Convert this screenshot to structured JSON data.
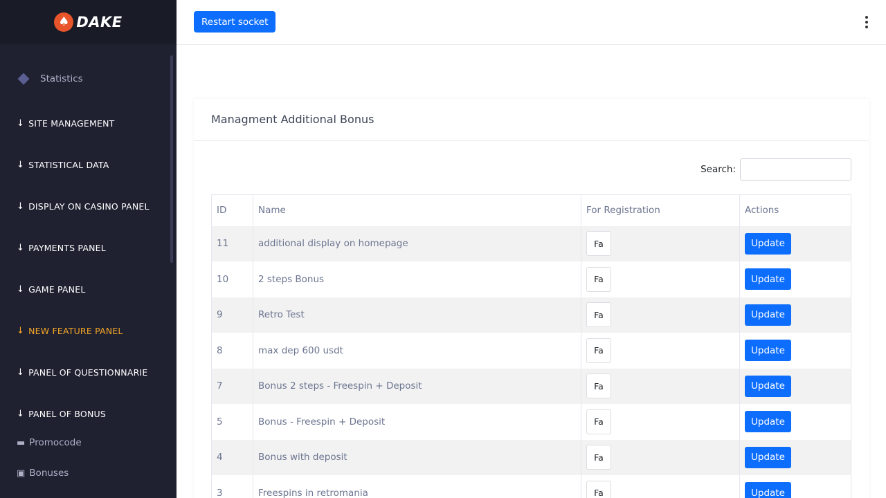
{
  "brand": {
    "name": "DAKE",
    "logo_icon": "spade-icon"
  },
  "topbar": {
    "restart_label": "Restart socket",
    "menu_icon": "kebab-menu-icon"
  },
  "sidebar": {
    "statistics_label": "Statistics",
    "sections": [
      {
        "label": "SITE MANAGEMENT",
        "active": false
      },
      {
        "label": "STATISTICAL DATA",
        "active": false
      },
      {
        "label": "DISPLAY ON CASINO PANEL",
        "active": false
      },
      {
        "label": "PAYMENTS PANEL",
        "active": false
      },
      {
        "label": "GAME PANEL",
        "active": false
      },
      {
        "label": "NEW FEATURE PANEL",
        "active": true
      },
      {
        "label": "PANEL OF QUESTIONNARIE",
        "active": false
      },
      {
        "label": "PANEL OF BONUS",
        "active": false
      }
    ],
    "sub_items": [
      {
        "label": "Promocode",
        "icon": "ticket-icon"
      },
      {
        "label": "Bonuses",
        "icon": "gift-icon"
      }
    ],
    "active_color": "#f7a726"
  },
  "card": {
    "title": "Managment Additional Bonus",
    "search_label": "Search:",
    "search_value": ""
  },
  "table": {
    "columns": [
      "ID",
      "Name",
      "For Registration",
      "Actions"
    ],
    "rows": [
      {
        "id": "11",
        "name": "additional display on homepage",
        "registration": "Fa",
        "action": "Update"
      },
      {
        "id": "10",
        "name": "2 steps Bonus",
        "registration": "Fa",
        "action": "Update"
      },
      {
        "id": "9",
        "name": "Retro Test",
        "registration": "Fa",
        "action": "Update"
      },
      {
        "id": "8",
        "name": "max dep 600 usdt",
        "registration": "Fa",
        "action": "Update"
      },
      {
        "id": "7",
        "name": "Bonus 2 steps - Freespin + Deposit",
        "registration": "Fa",
        "action": "Update"
      },
      {
        "id": "5",
        "name": "Bonus - Freespin + Deposit",
        "registration": "Fa",
        "action": "Update"
      },
      {
        "id": "4",
        "name": "Bonus with deposit",
        "registration": "Fa",
        "action": "Update"
      },
      {
        "id": "3",
        "name": "Freespins in retromania",
        "registration": "Fa",
        "action": "Update"
      }
    ]
  },
  "colors": {
    "primary": "#0d6efd",
    "sidebar_bg": "#1f2131",
    "brand_accent": "#e8552a"
  }
}
